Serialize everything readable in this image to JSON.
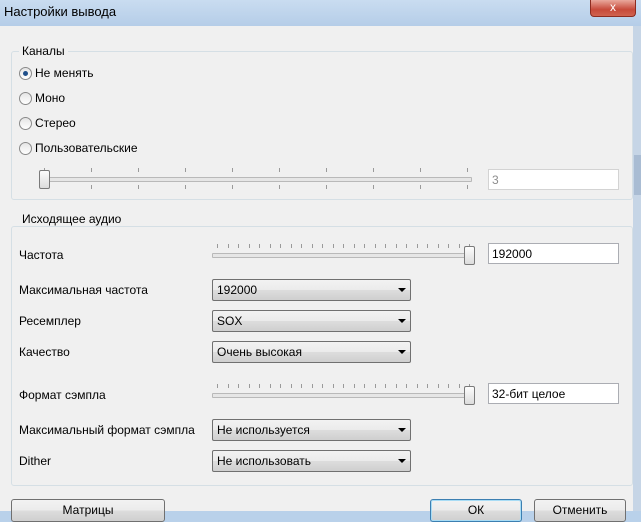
{
  "window": {
    "title": "Настройки вывода",
    "close_glyph": "x"
  },
  "channels": {
    "group_label": "Каналы",
    "options": [
      {
        "label": "Не менять",
        "checked": true
      },
      {
        "label": "Моно",
        "checked": false
      },
      {
        "label": "Стерео",
        "checked": false
      },
      {
        "label": "Пользовательские",
        "checked": false
      }
    ],
    "custom_value": "3",
    "slider_level": 0.0
  },
  "output": {
    "group_label": "Исходящее аудио",
    "frequency": {
      "label": "Частота",
      "value": "192000",
      "slider_level": 1.0
    },
    "max_frequency": {
      "label": "Максимальная частота",
      "value": "192000"
    },
    "resampler": {
      "label": "Ресемплер",
      "value": "SOX"
    },
    "quality": {
      "label": "Качество",
      "value": "Очень высокая"
    },
    "sample_format": {
      "label": "Формат сэмпла",
      "value": "32-бит целое",
      "slider_level": 1.0
    },
    "max_sample_format": {
      "label": "Максимальный формат сэмпла",
      "value": "Не используется"
    },
    "dither": {
      "label": "Dither",
      "value": "Не использовать"
    }
  },
  "buttons": {
    "matrices": "Матрицы",
    "ok": "ОК",
    "cancel": "Отменить"
  }
}
